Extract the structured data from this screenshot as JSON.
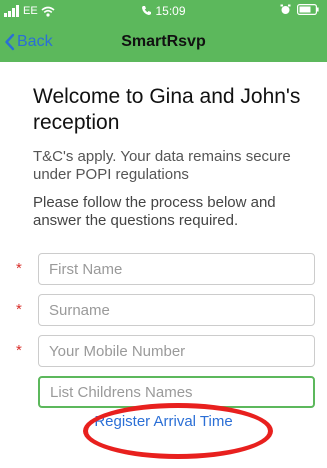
{
  "status_bar": {
    "carrier": "EE",
    "time": "15:09"
  },
  "nav": {
    "back_label": "Back",
    "title": "SmartRsvp"
  },
  "content": {
    "welcome": "Welcome to Gina and John's reception",
    "terms": "T&C's apply. Your data remains secure under POPI regulations",
    "instructions": "Please follow the process below and answer the questions required."
  },
  "form": {
    "required_marker": "*",
    "first_name": {
      "placeholder": "First Name",
      "value": ""
    },
    "surname": {
      "placeholder": "Surname",
      "value": ""
    },
    "mobile": {
      "placeholder": "Your Mobile Number",
      "value": ""
    },
    "children": {
      "placeholder": "List Childrens Names",
      "value": ""
    }
  },
  "actions": {
    "register_label": "Register Arrival Time"
  },
  "colors": {
    "header_green": "#5cb85c",
    "link_blue": "#2b6fd6",
    "required_red": "#d9302c",
    "annotation_red": "#e8201e"
  }
}
